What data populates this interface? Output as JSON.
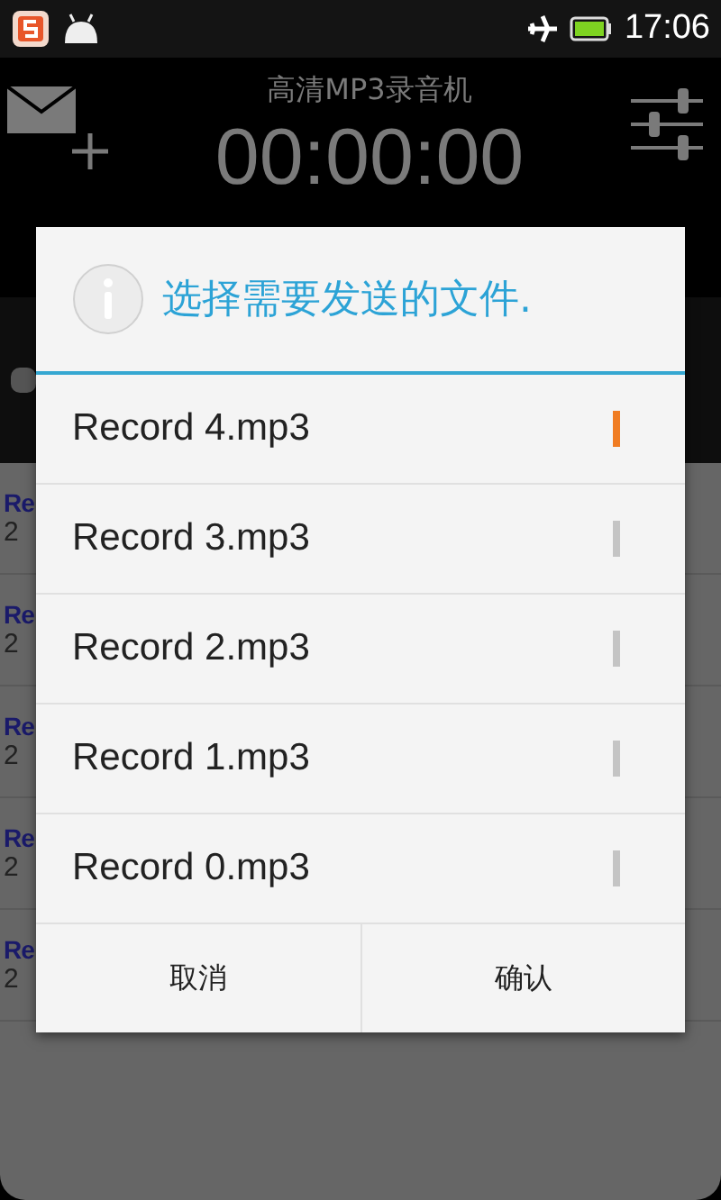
{
  "status_bar": {
    "time": "17:06"
  },
  "app": {
    "title": "高清MP3录音机",
    "timer": "00:00:00"
  },
  "recordings": [
    {
      "title": "Re",
      "date": "2"
    },
    {
      "title": "Re",
      "date": "2"
    },
    {
      "title": "Re",
      "date": "2"
    },
    {
      "title": "Re",
      "date": "2"
    },
    {
      "title": "Re",
      "date": "2"
    }
  ],
  "dialog": {
    "title": "选择需要发送的文件.",
    "files": [
      {
        "name": "Record 4.mp3",
        "selected": true
      },
      {
        "name": "Record 3.mp3",
        "selected": false
      },
      {
        "name": "Record 2.mp3",
        "selected": false
      },
      {
        "name": "Record 1.mp3",
        "selected": false
      },
      {
        "name": "Record 0.mp3",
        "selected": false
      }
    ],
    "buttons": [
      "取消",
      "确认"
    ]
  }
}
